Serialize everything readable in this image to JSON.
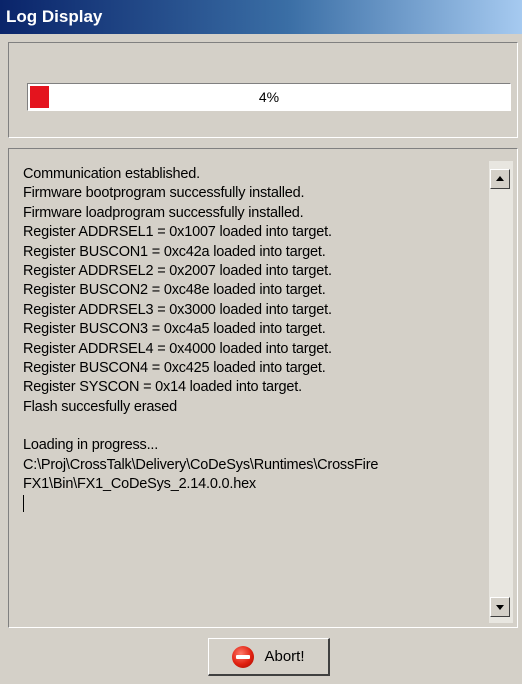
{
  "window": {
    "title": "Log Display"
  },
  "progress": {
    "percent": 4,
    "label": "4%",
    "fill_color": "#e4141e"
  },
  "log": {
    "lines": [
      "Communication established.",
      "Firmware bootprogram successfully installed.",
      "Firmware loadprogram successfully installed.",
      "Register ADDRSEL1 = 0x1007 loaded into target.",
      "Register BUSCON1 = 0xc42a loaded into target.",
      "Register ADDRSEL2 = 0x2007 loaded into target.",
      "Register BUSCON2 = 0xc48e loaded into target.",
      "Register ADDRSEL3 = 0x3000 loaded into target.",
      "Register BUSCON3 = 0xc4a5 loaded into target.",
      "Register ADDRSEL4 = 0x4000 loaded into target.",
      "Register BUSCON4 = 0xc425 loaded into target.",
      "Register SYSCON = 0x14 loaded into target.",
      "Flash succesfully erased",
      "",
      "Loading in progress...",
      "C:\\Proj\\CrossTalk\\Delivery\\CoDeSys\\Runtimes\\CrossFire",
      "FX1\\Bin\\FX1_CoDeSys_2.14.0.0.hex"
    ]
  },
  "buttons": {
    "abort_label": "Abort!",
    "abort_icon": "stop-icon"
  }
}
